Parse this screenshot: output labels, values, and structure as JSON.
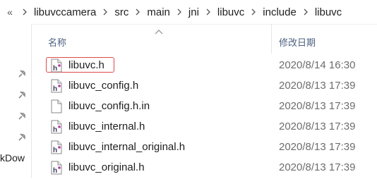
{
  "breadcrumb": {
    "more_glyph": "«",
    "segments": [
      "libuvccamera",
      "src",
      "main",
      "jni",
      "libuvc",
      "include",
      "libuvc"
    ]
  },
  "columns": {
    "name": "名称",
    "date_modified": "修改日期"
  },
  "files": [
    {
      "name": "libuvc.h",
      "date": "2020/8/14 16:30",
      "icon": "h-file-icon",
      "selected": true
    },
    {
      "name": "libuvc_config.h",
      "date": "2020/8/13 17:39",
      "icon": "h-file-icon"
    },
    {
      "name": "libuvc_config.h.in",
      "date": "2020/8/13 17:39",
      "icon": "blank-file-icon"
    },
    {
      "name": "libuvc_internal.h",
      "date": "2020/8/13 17:39",
      "icon": "h-file-icon"
    },
    {
      "name": "libuvc_internal_original.h",
      "date": "2020/8/13 17:39",
      "icon": "h-file-icon"
    },
    {
      "name": "libuvc_original.h",
      "date": "2020/8/13 17:39",
      "icon": "h-file-icon"
    }
  ],
  "sidebar": {
    "partial_label": "kDow"
  },
  "colors": {
    "selection_border": "#e04848",
    "header_text": "#4d6082",
    "date_text": "#6d6d6d"
  }
}
